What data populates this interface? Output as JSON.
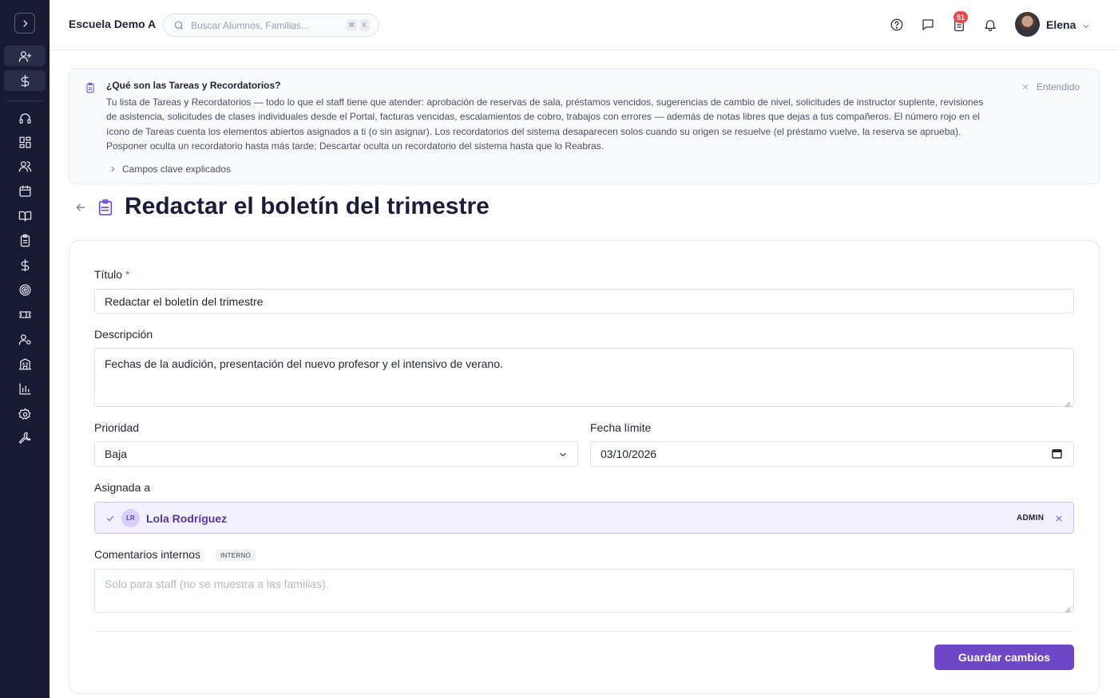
{
  "header": {
    "school_name": "Escuela Demo A",
    "search_placeholder": "Buscar Alumnos, Familias...",
    "search_shortcut": [
      "⌘",
      "K"
    ],
    "tasks_badge": "51",
    "user_name": "Elena"
  },
  "sidebar": {
    "items": [
      "expand-icon",
      "user-plus-icon",
      "dollar-icon",
      "headset-icon",
      "grid-icon",
      "users-icon",
      "calendar-icon",
      "book-icon",
      "clipboard-icon",
      "dollar-icon",
      "target-icon",
      "ticket-icon",
      "user-cog-icon",
      "building-icon",
      "chart-icon",
      "gear-icon",
      "wrench-icon"
    ]
  },
  "banner": {
    "title": "¿Qué son las Tareas y Recordatorios?",
    "text": "Tu lista de Tareas y Recordatorios — todo lo que el staff tiene que atender: aprobación de reservas de sala, préstamos vencidos, sugerencias de cambio de nivel, solicitudes de instructor suplente, revisiones de asistencia, solicitudes de clases individuales desde el Portal, facturas vencidas, escalamientos de cobro, trabajos con errores — además de notas libres que dejas a tus compañeros. El número rojo en el ícono de Tareas cuenta los elementos abiertos asignados a ti (o sin asignar). Los recordatorios del sistema desaparecen solos cuando su origen se resuelve (el préstamo vuelve, la reserva se aprueba). Posponer oculta un recordatorio hasta más tarde; Descartar oculta un recordatorio del sistema hasta que lo Reabras.",
    "dismiss_label": "Entendido",
    "expand_label": "Campos clave explicados"
  },
  "page": {
    "title": "Redactar el boletín del trimestre"
  },
  "form": {
    "title_label": "Título",
    "title_required": "*",
    "title_value": "Redactar el boletín del trimestre",
    "description_label": "Descripción",
    "description_value": "Fechas de la audición, presentación del nuevo profesor y el intensivo de verano.",
    "priority_label": "Prioridad",
    "priority_value": "Baja",
    "due_label": "Fecha límite",
    "due_value": "03/10/2026",
    "assigned_label": "Asignada a",
    "assignee": {
      "initials": "LR",
      "name": "Lola Rodríguez",
      "role": "ADMIN"
    },
    "comments_label": "Comentarios internos",
    "comments_tag": "INTERNO",
    "comments_placeholder": "Solo para staff (no se muestra a las familias).",
    "save_label": "Guardar cambios"
  },
  "colors": {
    "sidebar_bg": "#181a33",
    "accent": "#6d47c6",
    "badge": "#e5484d"
  }
}
